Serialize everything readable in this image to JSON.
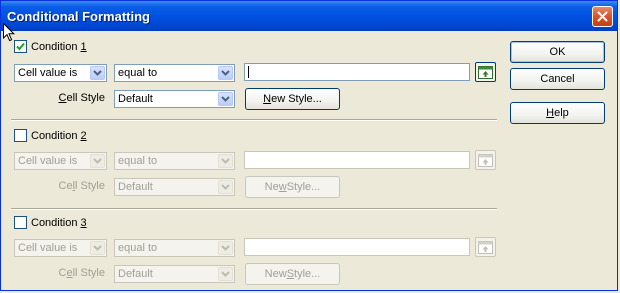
{
  "window": {
    "title": "Conditional Formatting"
  },
  "conditions": [
    {
      "label_pre": "Condition ",
      "label_key": "1",
      "checked": true,
      "type": "Cell value is",
      "operator": "equal to",
      "value": "",
      "cell_style_label_pre": "",
      "cell_style_label_key": "C",
      "cell_style_label_post": "ell Style",
      "style": "Default",
      "new_style_pre": "",
      "new_style_key": "N",
      "new_style_post": "ew Style..."
    },
    {
      "label_pre": "Condition ",
      "label_key": "2",
      "checked": false,
      "type": "Cell value is",
      "operator": "equal to",
      "value": "",
      "cell_style_label_pre": "Ce",
      "cell_style_label_key": "l",
      "cell_style_label_post": "l Style",
      "style": "Default",
      "new_style_pre": "Ne",
      "new_style_key": "w",
      "new_style_post": " Style..."
    },
    {
      "label_pre": "Condition ",
      "label_key": "3",
      "checked": false,
      "type": "Cell value is",
      "operator": "equal to",
      "value": "",
      "cell_style_label_pre": "C",
      "cell_style_label_key": "e",
      "cell_style_label_post": "ll Style",
      "style": "Default",
      "new_style_pre": "New ",
      "new_style_key": "S",
      "new_style_post": "tyle..."
    }
  ],
  "buttons": {
    "ok": "OK",
    "cancel": "Cancel",
    "help_key": "H",
    "help_rest": "elp"
  },
  "colors": {
    "titlebar": "#0054e3",
    "check": "#21a121",
    "dialog_bg": "#ece9d8"
  }
}
